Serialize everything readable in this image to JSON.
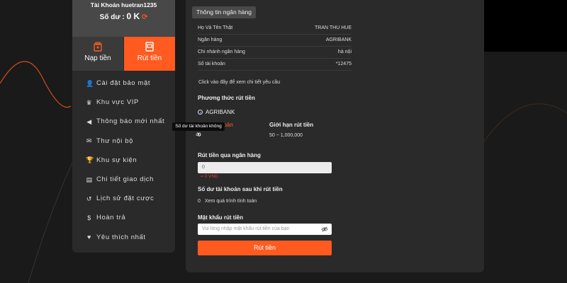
{
  "account": {
    "username_label": "Tài Khoản huetran1235",
    "balance_label": "Số dư :",
    "balance_value": "0 K",
    "refresh_icon": "refresh-icon"
  },
  "tabs": [
    {
      "label": "Nạp tiền",
      "icon": "wallet-icon"
    },
    {
      "label": "Rút tiền",
      "icon": "atm-icon"
    }
  ],
  "menu": [
    {
      "label": "Cài đặt bảo mật",
      "icon": "user-lock-icon"
    },
    {
      "label": "Khu vực VIP",
      "icon": "crown-icon"
    },
    {
      "label": "Thông báo mới nhất",
      "icon": "megaphone-icon"
    },
    {
      "label": "Thư nội bộ",
      "icon": "mail-icon"
    },
    {
      "label": "Khu sự kiện",
      "icon": "trophy-icon"
    },
    {
      "label": "Chi tiết giao dịch",
      "icon": "clipboard-icon"
    },
    {
      "label": "Lịch sử đặt cược",
      "icon": "history-icon"
    },
    {
      "label": "Hoàn trả",
      "icon": "dollar-circle-icon"
    },
    {
      "label": "Yêu thích nhất",
      "icon": "heart-icon"
    }
  ],
  "bank_info": {
    "tab_label": "Thông tin ngân hàng",
    "rows": [
      {
        "label": "Họ Và Tên Thật",
        "value": "TRAN THU HUE"
      },
      {
        "label": "Ngân hàng",
        "value": "AGRIBANK"
      },
      {
        "label": "Chi nhánh ngân hàng",
        "value": "hà nội"
      },
      {
        "label": "Số tài khoản",
        "value": "*12475"
      }
    ],
    "details_note": "Click vào đây để xem chi tiết yêu cầu"
  },
  "withdraw": {
    "method_heading": "Phương thức rút tiền",
    "method_option": "AGRIBANK",
    "balance_heading_partial": "hoản",
    "balance_value": "0",
    "limit_heading": "Giới hạn rút tiền",
    "limit_value": "50 ~ 1,000,000",
    "tooltip": "Số dư tài khoản không đủ",
    "amount_heading": "Rút tiền qua ngân hàng",
    "amount_value": "0",
    "amount_hint": "= 0 VND",
    "after_heading": "Số dư tài khoản sau khi rút tiền",
    "after_value": "0",
    "after_link": "Xem quá trình tính toán",
    "password_heading": "Mật khẩu rút tiền",
    "password_placeholder": "Vui lòng nhập mật khẩu rút tiền của bạn",
    "submit_label": "Rút tiền"
  },
  "colors": {
    "accent": "#ff5a1f",
    "panel": "#2a2a2a",
    "background": "#1a1a1a"
  }
}
